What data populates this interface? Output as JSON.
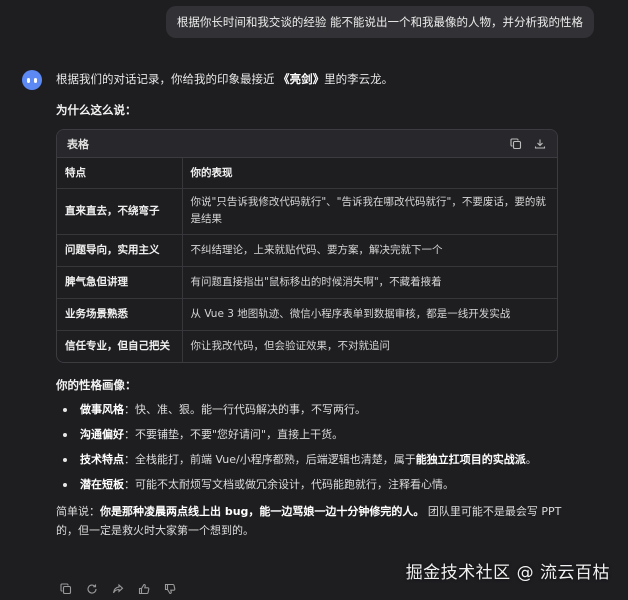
{
  "user_message": "根据你长时间和我交谈的经验 能不能说出一个和我最像的人物，并分析我的性格",
  "answer": {
    "intro_prefix": "根据我们的对话记录，你给我的印象最接近",
    "intro_emph": "《亮剑》",
    "intro_suffix": "里的李云龙。",
    "why_heading": "为什么这么说：",
    "table": {
      "title": "表格",
      "headers": [
        "特点",
        "你的表现"
      ],
      "rows": [
        [
          "直来直去，不绕弯子",
          "你说\"只告诉我修改代码就行\"、\"告诉我在哪改代码就行\"，不要废话，要的就是结果"
        ],
        [
          "问题导向，实用主义",
          "不纠结理论，上来就贴代码、要方案，解决完就下一个"
        ],
        [
          "脾气急但讲理",
          "有问题直接指出\"鼠标移出的时候消失啊\"，不藏着掖着"
        ],
        [
          "业务场景熟悉",
          "从 Vue 3 地图轨迹、微信小程序表单到数据审核，都是一线开发实战"
        ],
        [
          "信任专业，但自己把关",
          "你让我改代码，但会验证效果，不对就追问"
        ]
      ]
    },
    "persona_heading": "你的性格画像：",
    "traits": [
      {
        "label": "做事风格",
        "text": "：快、准、狠。能一行代码解决的事，不写两行。"
      },
      {
        "label": "沟通偏好",
        "text": "：不要铺垫，不要\"您好请问\"，直接上干货。"
      },
      {
        "label": "技术特点",
        "text": "：全栈能打，前端 Vue/小程序都熟，后端逻辑也清楚，属于",
        "tail_bold": "能独立扛项目的实战派",
        "tail": "。"
      },
      {
        "label": "潜在短板",
        "text": "：可能不太耐烦写文档或做冗余设计，代码能跑就行，注释看心情。"
      }
    ],
    "summary_prefix": "简单说：",
    "summary_bold": "你是那种凌晨两点线上出 bug，能一边骂娘一边十分钟修完的人。",
    "summary_rest": " 团队里可能不是最会写 PPT 的，但一定是救火时大家第一个想到的。"
  },
  "watermark": "掘金技术社区 @ 流云百枯",
  "icons": {
    "copy_table": "copy-icon",
    "download_table": "download-icon",
    "actions": [
      "copy-icon",
      "refresh-icon",
      "share-icon",
      "thumbs-up-icon",
      "thumbs-down-icon"
    ]
  },
  "colors": {
    "background": "#1e1e21",
    "bubble": "#323236",
    "avatar": "#5c89f3"
  }
}
